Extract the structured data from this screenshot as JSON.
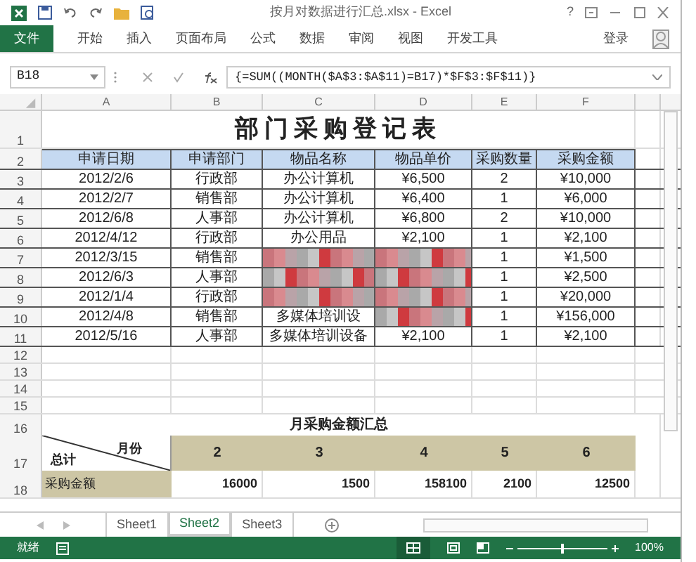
{
  "window": {
    "title": "按月对数据进行汇总.xlsx - Excel",
    "help": "?"
  },
  "ribbon": {
    "tabs": [
      {
        "label": "文件",
        "kind": "file"
      },
      {
        "label": "开始",
        "kind": "tab"
      },
      {
        "label": "插入",
        "kind": "tab"
      },
      {
        "label": "页面布局",
        "kind": "tab"
      },
      {
        "label": "公式",
        "kind": "tab"
      },
      {
        "label": "数据",
        "kind": "tab"
      },
      {
        "label": "审阅",
        "kind": "tab"
      },
      {
        "label": "视图",
        "kind": "tab"
      },
      {
        "label": "开发工具",
        "kind": "tab"
      }
    ],
    "sign_in": "登录"
  },
  "formula_bar": {
    "name_box": "B18",
    "formula": "{=SUM((MONTH($A$3:$A$11)=B17)*$F$3:$F$11)}"
  },
  "columns": [
    "A",
    "B",
    "C",
    "D",
    "E",
    "F"
  ],
  "row_numbers": [
    "1",
    "2",
    "3",
    "4",
    "5",
    "6",
    "7",
    "8",
    "9",
    "10",
    "11",
    "12",
    "13",
    "14",
    "15",
    "16",
    "17",
    "18"
  ],
  "title": "部门采购登记表",
  "table": {
    "columns": [
      "申请日期",
      "申请部门",
      "物品名称",
      "物品单价",
      "采购数量",
      "采购金额"
    ],
    "rows": [
      [
        "2012/2/6",
        "行政部",
        "办公计算机",
        "¥6,500",
        "2",
        "¥10,000"
      ],
      [
        "2012/2/7",
        "销售部",
        "办公计算机",
        "¥6,400",
        "1",
        "¥6,000"
      ],
      [
        "2012/6/8",
        "人事部",
        "办公计算机",
        "¥6,800",
        "2",
        "¥10,000"
      ],
      [
        "2012/4/12",
        "行政部",
        "办公用品",
        "¥2,100",
        "1",
        "¥2,100"
      ],
      [
        "2012/3/15",
        "销售部",
        null,
        null,
        "1",
        "¥1,500"
      ],
      [
        "2012/6/3",
        "人事部",
        null,
        null,
        "1",
        "¥2,500"
      ],
      [
        "2012/1/4",
        "行政部",
        null,
        null,
        "1",
        "¥20,000"
      ],
      [
        "2012/4/8",
        "销售部",
        "多媒体培训设",
        null,
        "1",
        "¥156,000"
      ],
      [
        "2012/5/16",
        "人事部",
        "多媒体培训设备",
        "¥2,100",
        "1",
        "¥2,100"
      ]
    ]
  },
  "summary": {
    "title": "月采购金额汇总",
    "corner_top": "月份",
    "corner_bottom": "总计",
    "months": [
      "2",
      "3",
      "4",
      "5",
      "6"
    ],
    "row_label": "采购金额",
    "values": [
      "16000",
      "1500",
      "158100",
      "2100",
      "12500"
    ]
  },
  "sheets": [
    {
      "label": "Sheet1",
      "selected": false
    },
    {
      "label": "Sheet2",
      "selected": true
    },
    {
      "label": "Sheet3",
      "selected": false
    }
  ],
  "status_bar": {
    "status": "就绪",
    "zoom": "100%",
    "zoom_slider": {
      "level": 0.5
    }
  }
}
